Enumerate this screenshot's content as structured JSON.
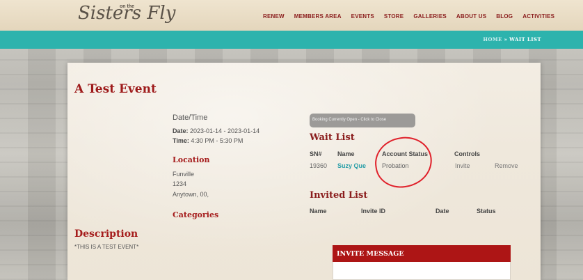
{
  "header": {
    "logo_text": "Sisters Fly",
    "logo_sup": "on the",
    "nav": [
      "RENEW",
      "MEMBERS AREA",
      "EVENTS",
      "STORE",
      "GALLERIES",
      "ABOUT US",
      "BLOG",
      "ACTIVITIES"
    ]
  },
  "breadcrumb": {
    "home": "HOME",
    "separator": " » ",
    "current": "WAIT LIST"
  },
  "event": {
    "title": "A Test Event",
    "datetime_heading": "Date/Time",
    "date_label": "Date:",
    "date_value": " 2023-01-14 - 2023-01-14",
    "time_label": "Time:",
    "time_value": " 4:30 PM - 5:30 PM",
    "location_heading": "Location",
    "location_lines": [
      "Funville",
      "1234",
      "Anytown, 00,"
    ],
    "categories_heading": "Categories",
    "description_heading": "Description",
    "description_text": "*THIS IS A TEST EVENT*"
  },
  "booking_button": "Booking Currently Open - Click to Close",
  "wait_list": {
    "heading": "Wait List",
    "columns": [
      "SN#",
      "Name",
      "Account Status",
      "Controls"
    ],
    "rows": [
      {
        "sn": "19360",
        "name": "Suzy Que",
        "status": "Probation",
        "invite": "Invite",
        "remove": "Remove"
      }
    ]
  },
  "invited_list": {
    "heading": "Invited List",
    "columns": [
      "Name",
      "Invite ID",
      "Date",
      "Status"
    ]
  },
  "invite_message": {
    "heading": "INVITE MESSAGE"
  },
  "colors": {
    "teal": "#2db3ad",
    "brand_red": "#9e1b1b",
    "link_teal": "#2a9fa8",
    "annotation_red": "#e0212b"
  }
}
